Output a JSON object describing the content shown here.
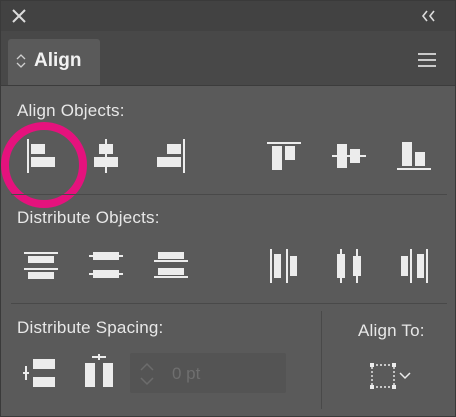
{
  "panel": {
    "tab_label": "Align",
    "colors": {
      "background": "#5a5a5a",
      "title_bar": "#424242",
      "icon": "#ececec",
      "highlight_ring": "#e5127d"
    }
  },
  "icons": {
    "close": "close-icon",
    "collapse": "double-chevron-left-icon",
    "tab_arrows": "up-down-arrows-icon",
    "menu": "hamburger-menu-icon"
  },
  "align_objects": {
    "label": "Align Objects:",
    "buttons": [
      "horizontal-align-left",
      "horizontal-align-center",
      "horizontal-align-right",
      "vertical-align-top",
      "vertical-align-center",
      "vertical-align-bottom"
    ],
    "highlighted_button": "horizontal-align-left"
  },
  "distribute_objects": {
    "label": "Distribute Objects:",
    "buttons": [
      "vertical-distribute-top",
      "vertical-distribute-center",
      "vertical-distribute-bottom",
      "horizontal-distribute-left",
      "horizontal-distribute-center",
      "horizontal-distribute-right"
    ]
  },
  "distribute_spacing": {
    "label": "Distribute Spacing:",
    "buttons": [
      "vertical-distribute-space",
      "horizontal-distribute-space"
    ],
    "spacing_value": "",
    "spacing_placeholder": "0 pt"
  },
  "align_to": {
    "label": "Align To:",
    "icon": "align-to-selection-icon"
  }
}
